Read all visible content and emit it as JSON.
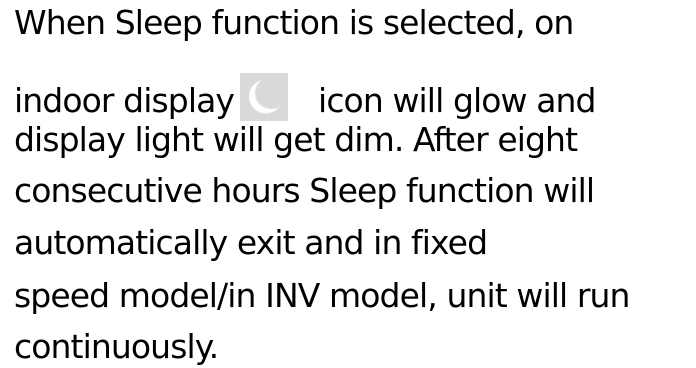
{
  "document": {
    "lines": [
      "When Sleep function is selected, on",
      "indoor display",
      "icon will glow and",
      "display light will get dim. After eight",
      "consecutive hours Sleep function will",
      "automatically exit and in fixed",
      "speed model/in INV model, unit will run",
      "continuously."
    ],
    "inline_icon": "moon-icon",
    "icon_background": "#d9d9d9",
    "icon_color": "#ffffff"
  }
}
